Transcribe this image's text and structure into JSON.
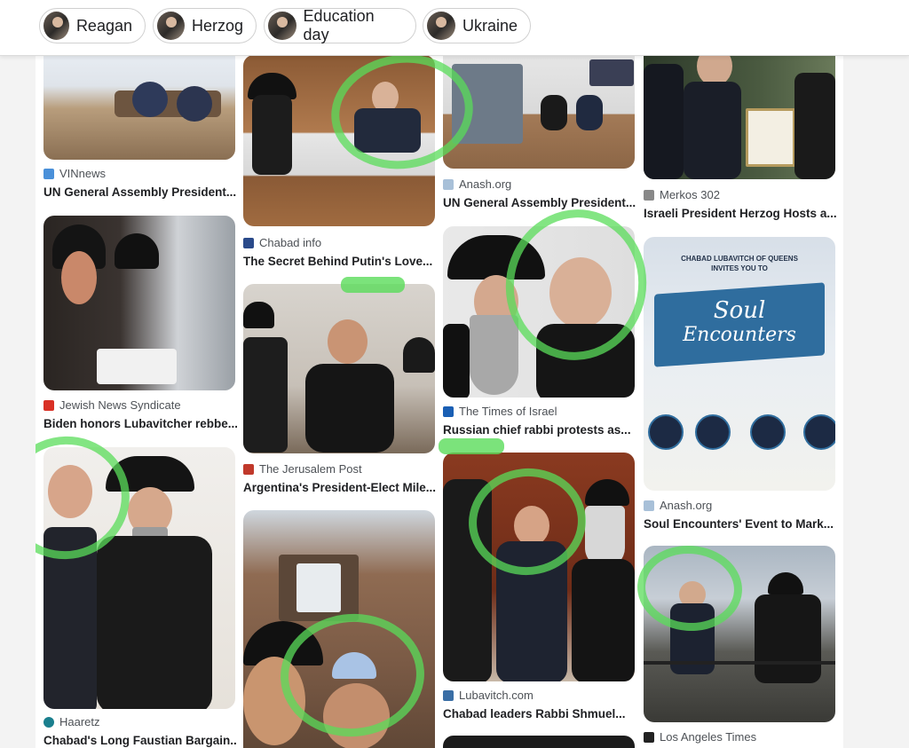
{
  "chips": [
    {
      "label": "Reagan"
    },
    {
      "label": "Herzog"
    },
    {
      "label": "Education day"
    },
    {
      "label": "Ukraine"
    }
  ],
  "cards": {
    "c1": {
      "source": "VINnews",
      "title": "UN General Assembly President..."
    },
    "c2": {
      "source": "Jewish News Syndicate",
      "title": "Biden honors Lubavitcher rebbe..."
    },
    "c3": {
      "source": "Haaretz",
      "title": "Chabad's Long Faustian Bargain..."
    },
    "c4": {
      "source": "Chabad info",
      "title": "The Secret Behind Putin's Love..."
    },
    "c5": {
      "source": "The Jerusalem Post",
      "title": "Argentina's President-Elect Mile..."
    },
    "c6": {
      "source": "Anash.org",
      "title": "UN General Assembly President..."
    },
    "c7": {
      "source": "The Times of Israel",
      "title": "Russian chief rabbi protests as..."
    },
    "c8": {
      "source": "Lubavitch.com",
      "title": "Chabad leaders Rabbi Shmuel..."
    },
    "c9": {
      "source": "Merkos 302",
      "title": "Israeli President Herzog Hosts a..."
    },
    "c10": {
      "source": "Anash.org",
      "title": "Soul Encounters' Event to Mark..."
    },
    "c11": {
      "source": "Los Angeles Times",
      "title": ""
    }
  },
  "poster": {
    "heading_line1": "CHABAD LUBAVITCH OF QUEENS",
    "heading_line2": "INVITES YOU TO",
    "banner_line1": "Soul",
    "banner_line2": "Encounters"
  },
  "source_icon_colors": {
    "vinnews": "#4a90d9",
    "jns": "#d93025",
    "haaretz": "#1a7f8e",
    "chabadinfo": "#2a4a8a",
    "jpost": "#c0392b",
    "anash": "#a8c0d8",
    "times_of_israel": "#1a5fb4",
    "lubavitch": "#3a6ea5",
    "merkos": "#888888",
    "latimes": "#222222"
  },
  "annotation_color": "#5adc5a"
}
